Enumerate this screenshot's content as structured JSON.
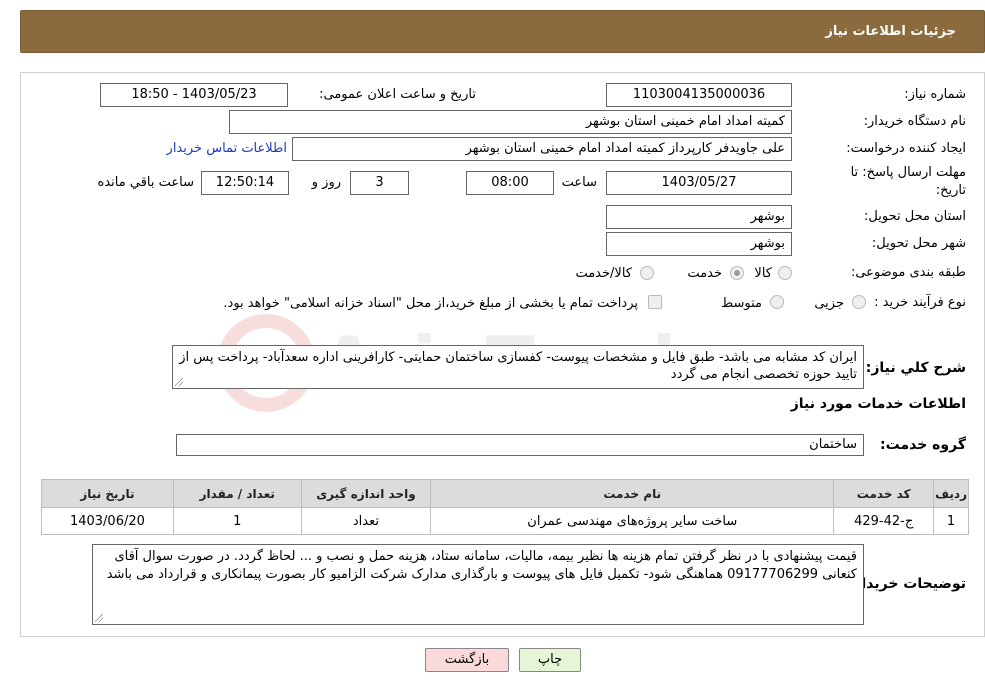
{
  "header": {
    "title": "جزئیات اطلاعات نیاز"
  },
  "form": {
    "need_number_label": "شماره نیاز:",
    "need_number": "1103004135000036",
    "announce_label": "تاریخ و ساعت اعلان عمومی:",
    "announce_value": "1403/05/23 - 18:50",
    "buyer_org_label": "نام دستگاه خریدار:",
    "buyer_org": "کمیته امداد امام خمینی استان بوشهر",
    "creator_label": "ایجاد کننده درخواست:",
    "creator": "علی جاویدفر کارپرداز کمیته امداد امام خمینی استان بوشهر",
    "contact_link": "اطلاعات تماس خریدار",
    "deadline_label_1": "مهلت ارسال پاسخ: تا",
    "deadline_label_2": "تاریخ:",
    "deadline_date": "1403/05/27",
    "time_label": "ساعت",
    "deadline_time": "08:00",
    "days_value": "3",
    "days_label": "روز و",
    "remaining_time": "12:50:14",
    "remaining_label": "ساعت باقي مانده",
    "delivery_province_label": "استان محل تحویل:",
    "delivery_province": "بوشهر",
    "delivery_city_label": "شهر محل تحویل:",
    "delivery_city": "بوشهر",
    "category_label": "طبقه بندی موضوعی:",
    "category_options": [
      {
        "label": "کالا",
        "selected": false
      },
      {
        "label": "خدمت",
        "selected": true
      },
      {
        "label": "کالا/خدمت",
        "selected": false
      }
    ],
    "process_label": "نوع فرآیند خرید :",
    "process_options": [
      {
        "label": "جزیی",
        "selected": false
      },
      {
        "label": "متوسط",
        "selected": false
      },
      {
        "label": "پرداخت تمام یا بخشی از مبلغ خرید،از محل \"اسناد خزانه اسلامی\" خواهد بود.",
        "selected": false
      }
    ]
  },
  "summary": {
    "label": "شرح کلي نياز:",
    "text": "ایران کد مشابه می باشد- طبق فایل و مشخصات پیوست- کفسازی ساختمان حمایتی- کارافرینی اداره سعدآباد- پرداخت پس از تایید حوزه تخصصی انجام می گردد"
  },
  "services_section": {
    "title": "اطلاعات خدمات مورد نیاز",
    "group_label": "گروه خدمت:",
    "group_value": "ساختمان"
  },
  "table": {
    "headers": [
      "ردیف",
      "کد خدمت",
      "نام خدمت",
      "واحد اندازه گیری",
      "تعداد / مقدار",
      "تاریخ نیاز"
    ],
    "rows": [
      [
        "1",
        "ج-42-429",
        "ساخت سایر پروژه‌های مهندسی عمران",
        "تعداد",
        "1",
        "1403/06/20"
      ]
    ]
  },
  "buyer_notes": {
    "label": "توضیحات خریدار:",
    "text": "قیمت پیشنهادی با در نظر گرفتن تمام هزینه ها نظیر بیمه، مالیات، سامانه ستاد، هزینه حمل و نصب و ... لحاظ گردد. در صورت سوال آقای کنعانی 09177706299 هماهنگی شود- تکمیل فایل های پیوست و بارگذاری مدارک شرکت الزامیو کار بصورت پیمانکاری و قرارداد می باشد"
  },
  "buttons": {
    "print": "چاپ",
    "back": "بازگشت"
  },
  "watermark": {
    "text": "AriaTender.neT"
  },
  "colors": {
    "header_bg": "#8b6a3e",
    "print_btn": "#e6f5d6",
    "back_btn": "#f9d9d9",
    "table_header": "#dcdcdc"
  }
}
